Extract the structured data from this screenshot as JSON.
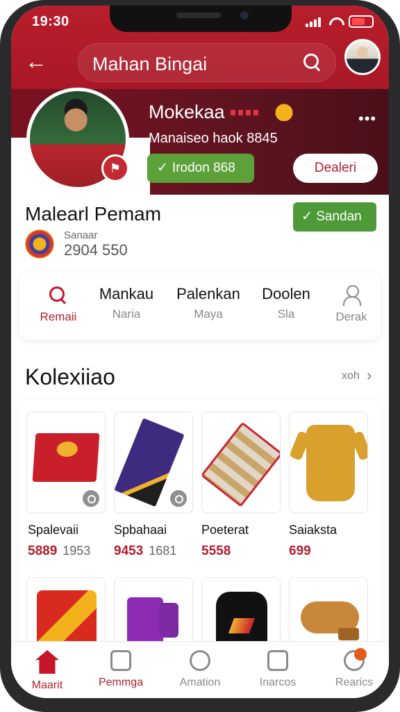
{
  "status": {
    "time": "19:30"
  },
  "topbar": {
    "title": "Mahan Bingai"
  },
  "profile": {
    "name": "Mokekaa",
    "subline": "Manaiseo haok 8845",
    "stat_label": "Irodon 868",
    "action_label": "Dealeri"
  },
  "section": {
    "title": "Malearl Pemam",
    "team_label": "Sanaar",
    "team_value": "2904 550",
    "verify_label": "Sandan"
  },
  "nav": [
    {
      "label1": "",
      "label2": "Remaii"
    },
    {
      "label1": "Mankau",
      "label2": "Naria"
    },
    {
      "label1": "Palenkan",
      "label2": "Maya"
    },
    {
      "label1": "Doolen",
      "label2": "Sla"
    },
    {
      "label1": "",
      "label2": "Derak"
    }
  ],
  "collection": {
    "title": "Kolexiiao",
    "see_all": "xoh"
  },
  "products": [
    {
      "name": "Spalevaii",
      "price": "5889",
      "old_price": "1953"
    },
    {
      "name": "Spbahaai",
      "price": "9453",
      "old_price": "1681"
    },
    {
      "name": "Poeterat",
      "price": "5558",
      "old_price": ""
    },
    {
      "name": "Saiaksta",
      "price": "699",
      "old_price": ""
    }
  ],
  "tabs": [
    {
      "label": "Maarit"
    },
    {
      "label": "Pemmga"
    },
    {
      "label": "Amation"
    },
    {
      "label": "Inarcos"
    },
    {
      "label": "Rearics"
    }
  ],
  "colors": {
    "brand_red": "#b11f2e",
    "green": "#5da13a"
  }
}
